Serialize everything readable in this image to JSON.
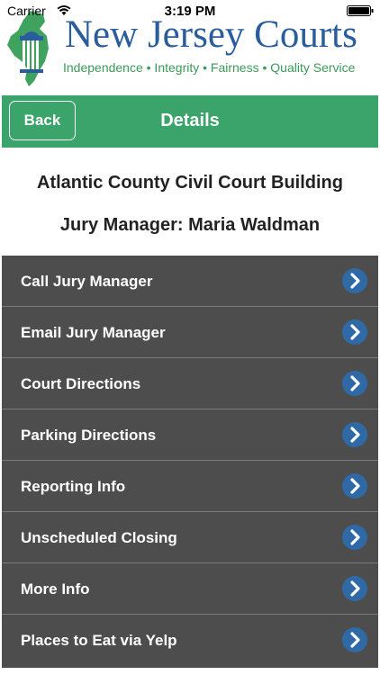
{
  "status_bar": {
    "carrier": "Carrier",
    "time": "3:19 PM"
  },
  "banner": {
    "title": "New Jersey Courts",
    "tagline": "Independence • Integrity • Fairness • Quality Service"
  },
  "nav": {
    "back_label": "Back",
    "title": "Details"
  },
  "details": {
    "court_name": "Atlantic County Civil Court Building",
    "manager": "Jury Manager: Maria Waldman"
  },
  "menu": {
    "items": [
      {
        "label": "Call Jury Manager"
      },
      {
        "label": "Email Jury Manager"
      },
      {
        "label": "Court Directions"
      },
      {
        "label": "Parking Directions"
      },
      {
        "label": "Reporting Info"
      },
      {
        "label": "Unscheduled Closing"
      },
      {
        "label": "More Info"
      },
      {
        "label": "Places to Eat via Yelp"
      }
    ]
  },
  "colors": {
    "nav_green": "#3aa46a",
    "brand_blue": "#2a5d9e",
    "tagline_green": "#3c9a58",
    "list_bg": "#4d4d4d",
    "chevron_circle": "#2f6aa6"
  }
}
